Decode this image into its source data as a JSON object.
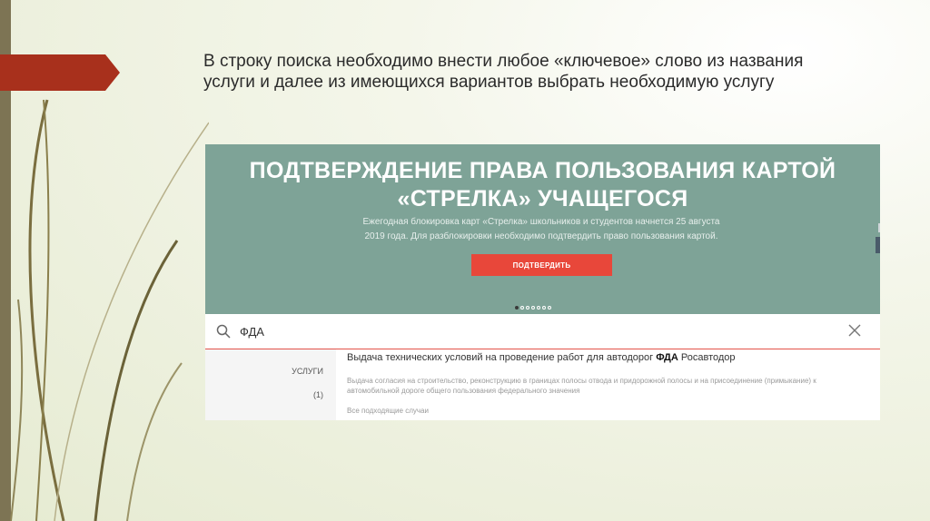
{
  "slide": {
    "intro_text": "В строку поиска необходимо внести любое «ключевое» слово из названия услуги и далее из имеющихся вариантов выбрать необходимую услугу"
  },
  "banner": {
    "title_line1": "ПОДТВЕРЖДЕНИЕ ПРАВА ПОЛЬЗОВАНИЯ КАРТОЙ",
    "title_line2": "«СТРЕЛКА» УЧАЩЕГОСЯ",
    "subtitle_line1": "Ежегодная блокировка карт «Стрелка» школьников и студентов начнется 25 августа",
    "subtitle_line2": "2019 года. Для разблокировки необходимо подтвердить право пользования картой.",
    "button_label": "ПОДТВЕРДИТЬ",
    "carousel_dots": 7,
    "carousel_active": 1
  },
  "search": {
    "value": "ФДА"
  },
  "results": {
    "category": "УСЛУГИ",
    "count": "(1)",
    "item": {
      "title_before": "Выдача технических условий на проведение работ для автодорог ",
      "title_highlight": "ФДА",
      "title_after": " Росавтодор",
      "description": "Выдача согласия на строительство, реконструкцию в границах полосы отвода и придорожной полосы и на присоединение (примыкание) к автомобильной дороге общего пользования федерального значения"
    },
    "all_link": "Все подходящие случаи"
  },
  "colors": {
    "banner_bg": "#7ea397",
    "button_bg": "#e8473a",
    "arrow_marker": "#a8301c",
    "left_stripe": "#7d7454"
  },
  "icons": [
    "search-icon",
    "close-icon"
  ]
}
